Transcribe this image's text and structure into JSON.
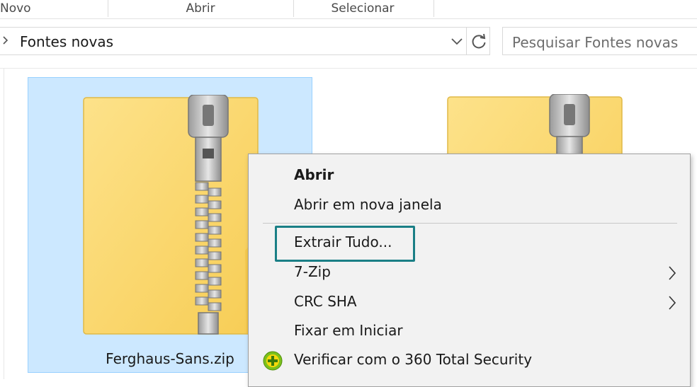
{
  "ribbon": {
    "groups": [
      "Novo",
      "Abrir",
      "Selecionar"
    ]
  },
  "address_bar": {
    "path": "Fontes novas",
    "icons": [
      "chevron-right-icon",
      "chevron-down-icon",
      "refresh-icon"
    ]
  },
  "search": {
    "placeholder": "Pesquisar Fontes novas"
  },
  "files": [
    {
      "name": "Ferghaus-Sans.zip",
      "selected": true,
      "icon": "zip-folder-icon"
    },
    {
      "name": "",
      "selected": false,
      "icon": "zip-folder-icon"
    }
  ],
  "context_menu": {
    "items": [
      {
        "label": "Abrir",
        "bold": true
      },
      {
        "label": "Abrir em nova janela"
      },
      {
        "label": "Extrair Tudo...",
        "highlighted": true
      },
      {
        "label": "7-Zip",
        "submenu": true
      },
      {
        "label": "CRC SHA",
        "submenu": true
      },
      {
        "label": "Fixar em Iniciar"
      },
      {
        "label": "Verificar com o 360 Total Security",
        "icon": "360-total-security-icon"
      }
    ]
  },
  "colors": {
    "selection_fill": "#cce8ff",
    "selection_border": "#99d1ff",
    "highlight_border": "#1a7f86",
    "menu_background": "#f2f2f2",
    "folder_yellow": "#ffd96a"
  }
}
